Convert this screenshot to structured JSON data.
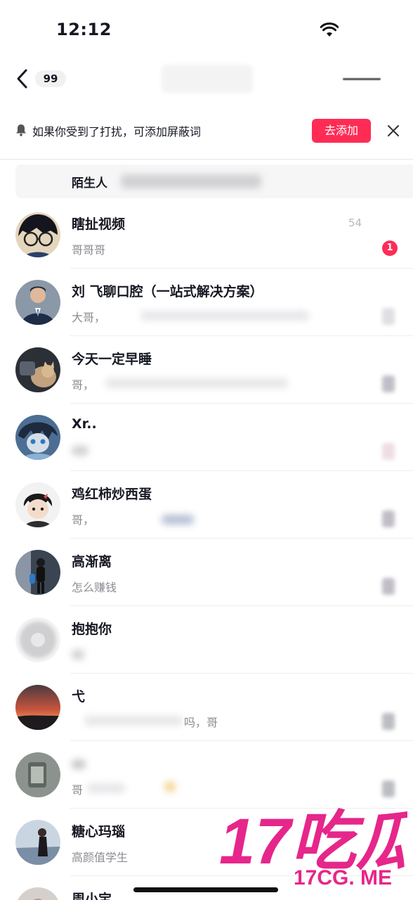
{
  "status_bar": {
    "time": "12:12"
  },
  "nav": {
    "badge_count": "99"
  },
  "notice": {
    "text": "如果你受到了打扰，可添加屏蔽词",
    "button_label": "去添加"
  },
  "stranger_banner": {
    "label": "陌生人"
  },
  "conversations": [
    {
      "name": "瞎扯视频",
      "preview": "哥哥哥",
      "time": "54",
      "unread": "1"
    },
    {
      "name": "刘 飞聊口腔（一站式解决方案）",
      "preview": "大哥，"
    },
    {
      "name": "今天一定早睡",
      "preview": "哥，"
    },
    {
      "name": "Xr..",
      "preview": ""
    },
    {
      "name": "鸡红柿炒西蛋",
      "preview": "哥，"
    },
    {
      "name": "高渐离",
      "preview": "怎么赚钱"
    },
    {
      "name": "抱抱你",
      "preview": ""
    },
    {
      "name": "弋",
      "preview": "吗，哥"
    },
    {
      "name": "",
      "preview": "哥"
    },
    {
      "name": "糖心玛瑙",
      "preview": "高颜值学生"
    },
    {
      "name": "周小宝",
      "preview": ""
    }
  ],
  "watermark": {
    "logo": "17吃瓜",
    "url": "17CG. ME"
  },
  "colors": {
    "accent": "#fe2c55",
    "watermark": "#e6268a"
  }
}
